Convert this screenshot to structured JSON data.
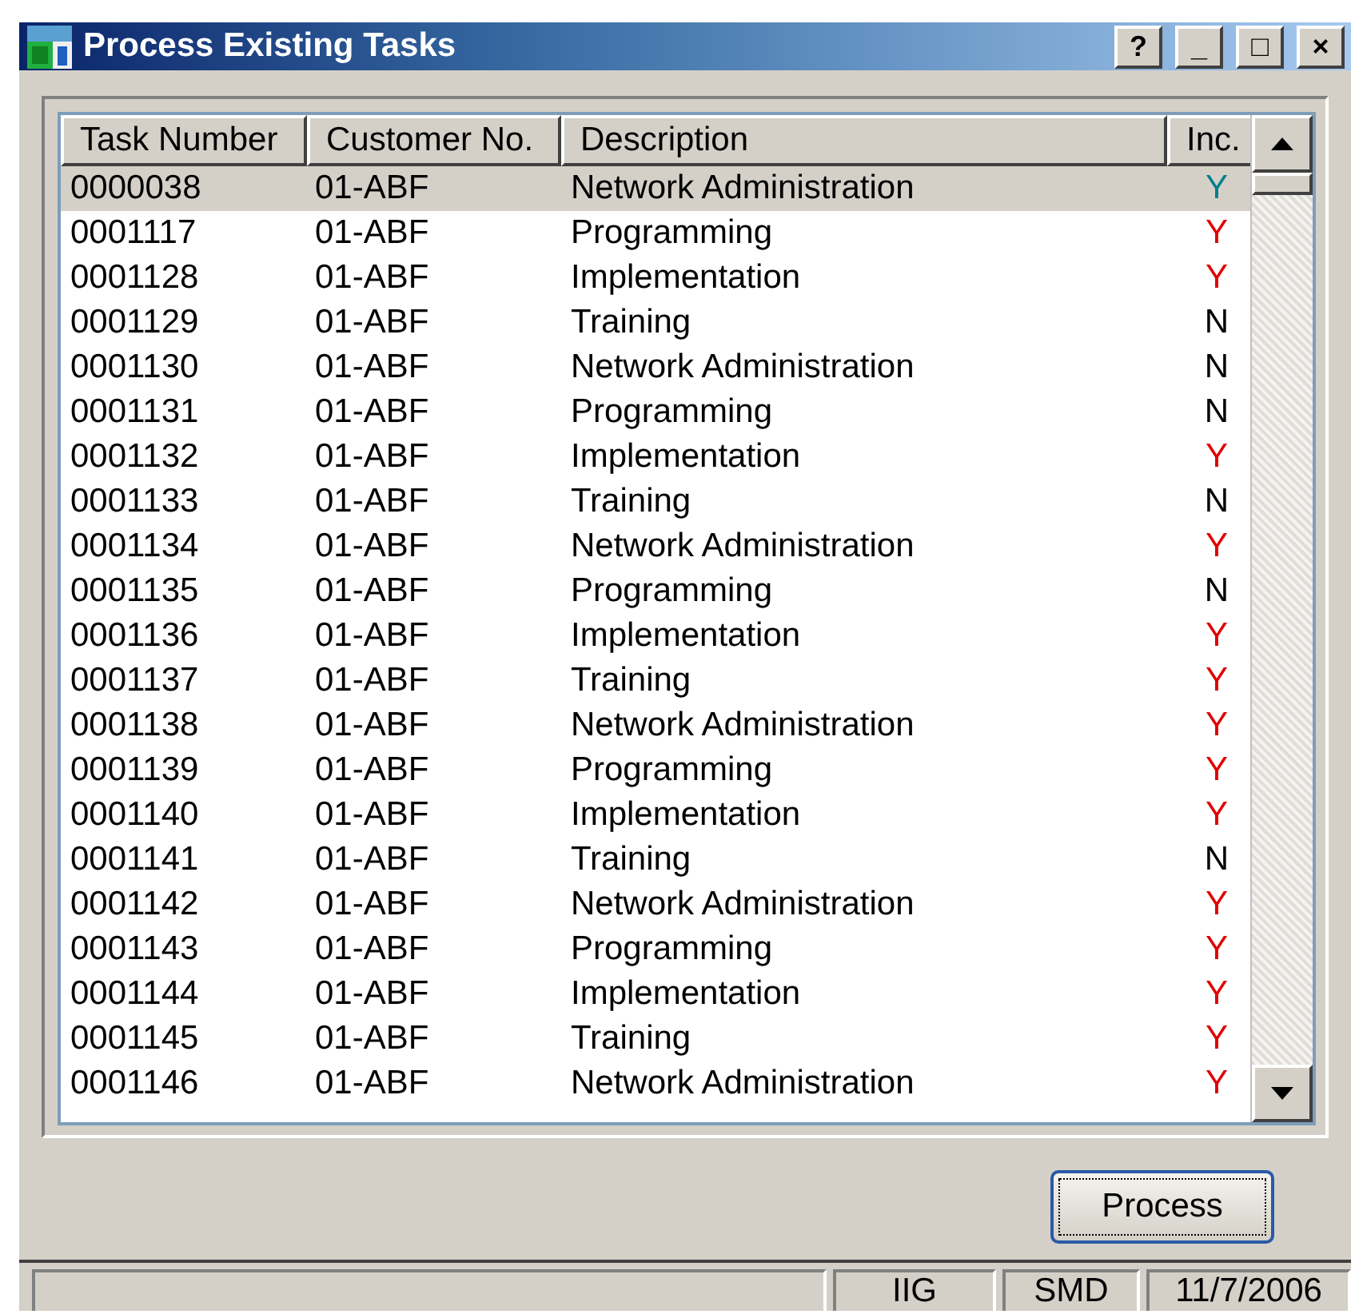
{
  "window": {
    "title": "Process Existing Tasks",
    "controls": [
      "?",
      "_",
      "□",
      "×"
    ]
  },
  "table": {
    "columns": [
      "Task Number",
      "Customer No.",
      "Description",
      "Inc."
    ],
    "rows": [
      {
        "task": "0000038",
        "customer": "01-ABF",
        "description": "Network Administration",
        "inc": "Y",
        "included": true,
        "selected": true
      },
      {
        "task": "0001117",
        "customer": "01-ABF",
        "description": "Programming",
        "inc": "Y",
        "included": true,
        "selected": false
      },
      {
        "task": "0001128",
        "customer": "01-ABF",
        "description": "Implementation",
        "inc": "Y",
        "included": true,
        "selected": false
      },
      {
        "task": "0001129",
        "customer": "01-ABF",
        "description": "Training",
        "inc": "N",
        "included": false,
        "selected": false
      },
      {
        "task": "0001130",
        "customer": "01-ABF",
        "description": "Network Administration",
        "inc": "N",
        "included": false,
        "selected": false
      },
      {
        "task": "0001131",
        "customer": "01-ABF",
        "description": "Programming",
        "inc": "N",
        "included": false,
        "selected": false
      },
      {
        "task": "0001132",
        "customer": "01-ABF",
        "description": "Implementation",
        "inc": "Y",
        "included": true,
        "selected": false
      },
      {
        "task": "0001133",
        "customer": "01-ABF",
        "description": "Training",
        "inc": "N",
        "included": false,
        "selected": false
      },
      {
        "task": "0001134",
        "customer": "01-ABF",
        "description": "Network Administration",
        "inc": "Y",
        "included": true,
        "selected": false
      },
      {
        "task": "0001135",
        "customer": "01-ABF",
        "description": "Programming",
        "inc": "N",
        "included": false,
        "selected": false
      },
      {
        "task": "0001136",
        "customer": "01-ABF",
        "description": "Implementation",
        "inc": "Y",
        "included": true,
        "selected": false
      },
      {
        "task": "0001137",
        "customer": "01-ABF",
        "description": "Training",
        "inc": "Y",
        "included": true,
        "selected": false
      },
      {
        "task": "0001138",
        "customer": "01-ABF",
        "description": "Network Administration",
        "inc": "Y",
        "included": true,
        "selected": false
      },
      {
        "task": "0001139",
        "customer": "01-ABF",
        "description": "Programming",
        "inc": "Y",
        "included": true,
        "selected": false
      },
      {
        "task": "0001140",
        "customer": "01-ABF",
        "description": "Implementation",
        "inc": "Y",
        "included": true,
        "selected": false
      },
      {
        "task": "0001141",
        "customer": "01-ABF",
        "description": "Training",
        "inc": "N",
        "included": false,
        "selected": false
      },
      {
        "task": "0001142",
        "customer": "01-ABF",
        "description": "Network Administration",
        "inc": "Y",
        "included": true,
        "selected": false
      },
      {
        "task": "0001143",
        "customer": "01-ABF",
        "description": "Programming",
        "inc": "Y",
        "included": true,
        "selected": false
      },
      {
        "task": "0001144",
        "customer": "01-ABF",
        "description": "Implementation",
        "inc": "Y",
        "included": true,
        "selected": false
      },
      {
        "task": "0001145",
        "customer": "01-ABF",
        "description": "Training",
        "inc": "Y",
        "included": true,
        "selected": false
      },
      {
        "task": "0001146",
        "customer": "01-ABF",
        "description": "Network Administration",
        "inc": "Y",
        "included": true,
        "selected": false
      }
    ]
  },
  "buttons": [
    "Process"
  ],
  "status_bar": [
    "IIG",
    "SMD",
    "11/7/2006"
  ]
}
